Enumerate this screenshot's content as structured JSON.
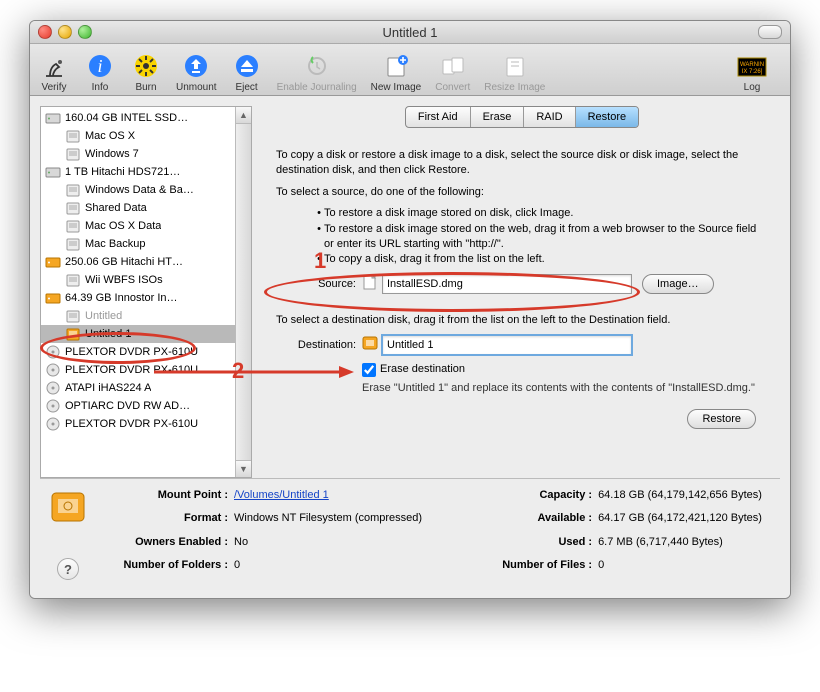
{
  "window": {
    "title": "Untitled 1"
  },
  "toolbar": {
    "items": [
      {
        "label": "Verify",
        "dim": false
      },
      {
        "label": "Info",
        "dim": false
      },
      {
        "label": "Burn",
        "dim": false
      },
      {
        "label": "Unmount",
        "dim": false
      },
      {
        "label": "Eject",
        "dim": false
      },
      {
        "label": "Enable Journaling",
        "dim": true
      },
      {
        "label": "New Image",
        "dim": false
      },
      {
        "label": "Convert",
        "dim": true
      },
      {
        "label": "Resize Image",
        "dim": true
      }
    ],
    "log": "Log"
  },
  "sidebar": {
    "items": [
      {
        "label": "160.04 GB INTEL SSD…",
        "type": "disk",
        "child": false
      },
      {
        "label": "Mac OS X",
        "type": "vol",
        "child": true
      },
      {
        "label": "Windows 7",
        "type": "vol",
        "child": true
      },
      {
        "label": "1 TB Hitachi HDS721…",
        "type": "disk",
        "child": false
      },
      {
        "label": "Windows Data & Ba…",
        "type": "vol",
        "child": true
      },
      {
        "label": "Shared Data",
        "type": "vol",
        "child": true
      },
      {
        "label": "Mac OS X Data",
        "type": "vol",
        "child": true
      },
      {
        "label": "Mac Backup",
        "type": "vol",
        "child": true
      },
      {
        "label": "250.06 GB Hitachi HT…",
        "type": "disk-ext",
        "child": false
      },
      {
        "label": "Wii WBFS ISOs",
        "type": "vol",
        "child": true
      },
      {
        "label": "64.39 GB Innostor In…",
        "type": "disk-ext",
        "child": false
      },
      {
        "label": "Untitled",
        "type": "vol",
        "child": true,
        "grey": true
      },
      {
        "label": "Untitled 1",
        "type": "vol-ext",
        "child": true,
        "selected": true
      },
      {
        "label": "PLEXTOR DVDR PX-610U",
        "type": "optical",
        "child": false
      },
      {
        "label": "PLEXTOR DVDR PX-610U",
        "type": "optical",
        "child": false
      },
      {
        "label": "ATAPI iHAS224 A",
        "type": "optical",
        "child": false
      },
      {
        "label": "OPTIARC DVD RW AD…",
        "type": "optical",
        "child": false
      },
      {
        "label": "PLEXTOR DVDR PX-610U",
        "type": "optical",
        "child": false
      }
    ]
  },
  "tabs": [
    "First Aid",
    "Erase",
    "RAID",
    "Restore"
  ],
  "active_tab": "Restore",
  "restore": {
    "intro": "To copy a disk or restore a disk image to a disk, select the source disk or disk image, select the destination disk, and then click Restore.",
    "src_head": "To select a source, do one of the following:",
    "src_b1": "To restore a disk image stored on disk, click Image.",
    "src_b2": "To restore a disk image stored on the web, drag it from a web browser to the Source field or enter its URL starting with \"http://\".",
    "src_b3": "To copy a disk, drag it from the list on the left.",
    "source_label": "Source:",
    "source_value": "InstallESD.dmg",
    "image_btn": "Image…",
    "dest_head": "To select a destination disk, drag it from the list on the left to the Destination field.",
    "dest_label": "Destination:",
    "dest_value": "Untitled 1",
    "erase_chk": "Erase destination",
    "erase_txt": "Erase \"Untitled 1\" and replace its contents with the contents of \"InstallESD.dmg.\"",
    "restore_btn": "Restore"
  },
  "annotations": {
    "one": "1",
    "two": "2"
  },
  "footer": {
    "leftkeys": [
      "Mount Point :",
      "Format :",
      "Owners Enabled :",
      "Number of Folders :"
    ],
    "leftvals_link": "/Volumes/Untitled 1",
    "leftvals": [
      "Windows NT Filesystem (compressed)",
      "No",
      "0"
    ],
    "rightkeys": [
      "Capacity :",
      "Available :",
      "Used :",
      "Number of Files :"
    ],
    "rightvals": [
      "64.18 GB (64,179,142,656 Bytes)",
      "64.17 GB (64,172,421,120 Bytes)",
      "6.7 MB (6,717,440 Bytes)",
      "0"
    ]
  }
}
